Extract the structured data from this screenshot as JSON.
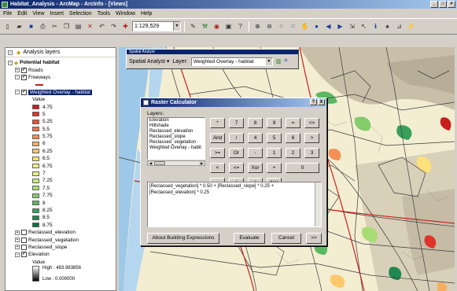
{
  "window": {
    "title": "Habitat_Analysis - ArcMap - ArcInfo - [Views]"
  },
  "menu": [
    "File",
    "Edit",
    "View",
    "Insert",
    "Selection",
    "Tools",
    "Window",
    "Help"
  ],
  "toolbar": {
    "scale": "1:129,529"
  },
  "toc": {
    "header": "Analysis layers",
    "group": "Potential habitat",
    "layers": [
      {
        "name": "Roads",
        "checked": true
      },
      {
        "name": "Freeways",
        "checked": true
      },
      {
        "name": "Weighted Overlay - habitat",
        "checked": true,
        "selected": true
      }
    ],
    "value_label": "Value",
    "legend": [
      {
        "value": "4.75",
        "color": "#c81e1e"
      },
      {
        "value": "5",
        "color": "#e0342a"
      },
      {
        "value": "5.25",
        "color": "#e8503a"
      },
      {
        "value": "5.5",
        "color": "#ee7046"
      },
      {
        "value": "5.75",
        "color": "#f49054"
      },
      {
        "value": "6",
        "color": "#f8ae60"
      },
      {
        "value": "6.25",
        "color": "#fcc86c"
      },
      {
        "value": "6.5",
        "color": "#fce07a"
      },
      {
        "value": "6.75",
        "color": "#f4ee84"
      },
      {
        "value": "7",
        "color": "#e4f084"
      },
      {
        "value": "7.25",
        "color": "#c8e87c"
      },
      {
        "value": "7.5",
        "color": "#a8dc74"
      },
      {
        "value": "7.75",
        "color": "#84cc6c"
      },
      {
        "value": "8",
        "color": "#5cb860"
      },
      {
        "value": "8.25",
        "color": "#38a05a"
      },
      {
        "value": "8.5",
        "color": "#208850"
      },
      {
        "value": "8.75",
        "color": "#107040"
      }
    ],
    "other_layers": [
      {
        "name": "Reclassed_elevation",
        "checked": false
      },
      {
        "name": "Reclassed_vegetation",
        "checked": false
      },
      {
        "name": "Reclassed_slope",
        "checked": false
      },
      {
        "name": "Elevation",
        "checked": true
      }
    ],
    "elevation": {
      "value_label": "Value",
      "high": "High : 483.983856",
      "low": "Low : 0.000000"
    }
  },
  "spatial_analyst": {
    "title": "Spatial Analyst",
    "menu_label": "Spatial Analyst",
    "layer_label": "Layer:",
    "layer_value": "Weighted Overlay - habitat"
  },
  "raster_calc": {
    "title": "Raster Calculator",
    "help": "?",
    "close": "X",
    "layers_label": "Layers:",
    "layers": [
      "Elevation",
      "Hillshade",
      "Reclassed_elevation",
      "Reclassed_slope",
      "Reclassed_vegetation",
      "Weighted Overlay - habit"
    ],
    "keys": [
      "*",
      "7",
      "8",
      "9",
      "=",
      "<>",
      "And",
      "/",
      "4",
      "5",
      "6",
      ">",
      ">=",
      "Or",
      "-",
      "1",
      "2",
      "3",
      "<",
      "<=",
      "Xor",
      "+",
      "0",
      ".",
      "(",
      ")",
      "Not"
    ],
    "expression": "[Reclassed_vegetation] * 0.50 + [Reclassed_slope] * 0.25 + [Reclassed_elevation] * 0.25",
    "about_button": "About Building Expressions",
    "evaluate_button": "Evaluate",
    "cancel_button": "Cancel",
    "more_button": ">>"
  }
}
